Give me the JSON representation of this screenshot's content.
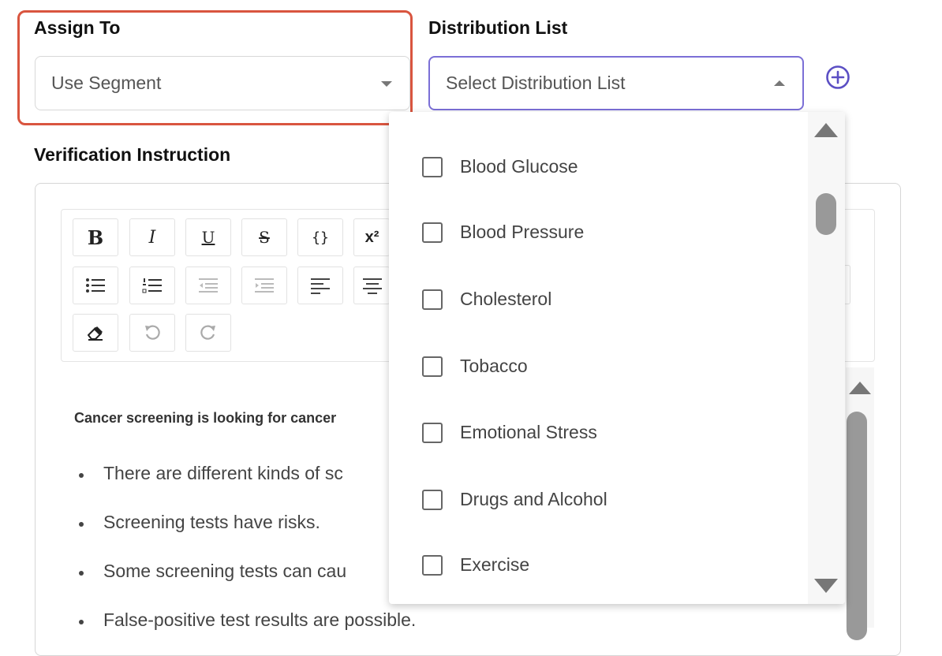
{
  "assign_to": {
    "label": "Assign To",
    "value": "Use Segment"
  },
  "distribution_list": {
    "label": "Distribution List",
    "placeholder": "Select Distribution List",
    "options": [
      {
        "label": "Blood Glucose",
        "checked": false
      },
      {
        "label": "Blood Pressure",
        "checked": false
      },
      {
        "label": "Cholesterol",
        "checked": false
      },
      {
        "label": "Tobacco",
        "checked": false
      },
      {
        "label": "Emotional Stress",
        "checked": false
      },
      {
        "label": "Drugs and Alcohol",
        "checked": false
      },
      {
        "label": "Exercise",
        "checked": false
      }
    ]
  },
  "verification": {
    "label": "Verification Instruction",
    "toolbar": {
      "bold": "B",
      "italic": "I",
      "underline": "U",
      "strike": "S",
      "code": "{}",
      "superscript": "x²"
    },
    "content": {
      "lead": "Cancer screening is looking for cancer",
      "bullets": [
        "There are different kinds of sc",
        "Screening tests have risks.",
        "Some screening tests can cau",
        "False-positive test results are possible."
      ]
    }
  },
  "colors": {
    "accent": "#6a5acd",
    "highlight": "#d9553f",
    "text": "#444444"
  }
}
